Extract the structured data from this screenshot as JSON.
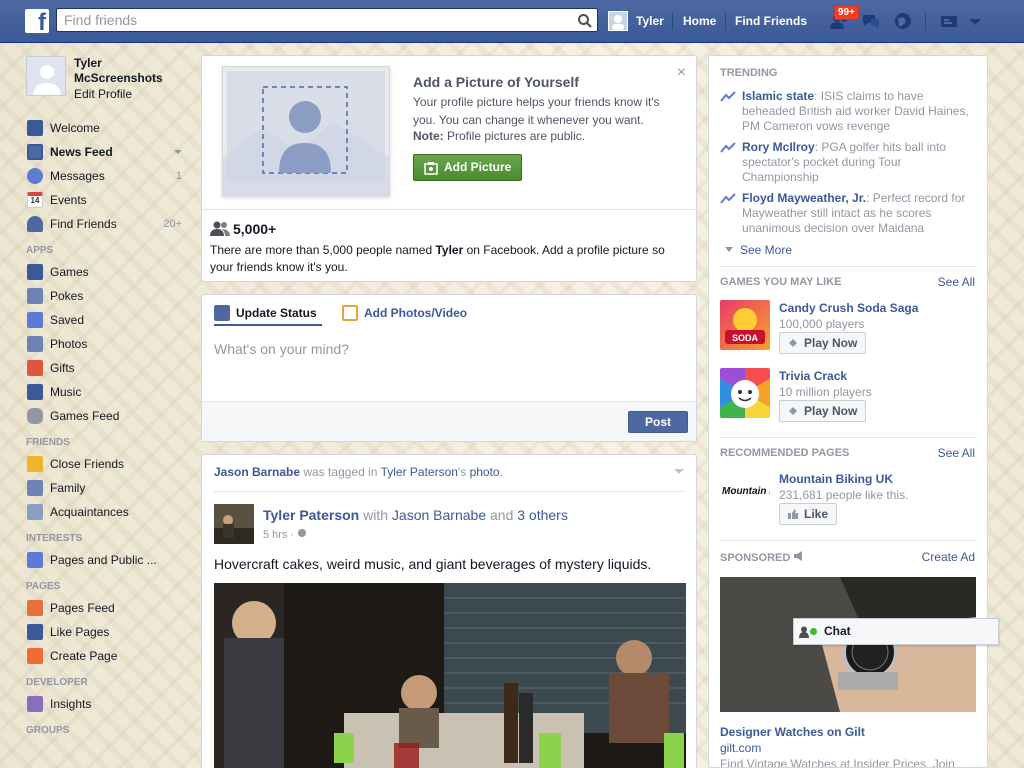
{
  "topbar": {
    "logo": "f",
    "search_placeholder": "Find friends",
    "user_name": "Tyler",
    "home": "Home",
    "find_friends": "Find Friends",
    "friend_requests_badge": "99+"
  },
  "profile": {
    "name": "Tyler McScreenshots",
    "edit": "Edit Profile"
  },
  "nav": {
    "main": [
      {
        "label": "Welcome"
      },
      {
        "label": "News Feed"
      },
      {
        "label": "Messages",
        "count": "1"
      },
      {
        "label": "Events",
        "icon_text": "14"
      },
      {
        "label": "Find Friends",
        "count": "20+"
      }
    ],
    "apps_heading": "APPS",
    "apps": [
      {
        "label": "Games"
      },
      {
        "label": "Pokes"
      },
      {
        "label": "Saved"
      },
      {
        "label": "Photos"
      },
      {
        "label": "Gifts"
      },
      {
        "label": "Music"
      },
      {
        "label": "Games Feed"
      }
    ],
    "friends_heading": "FRIENDS",
    "friends": [
      {
        "label": "Close Friends"
      },
      {
        "label": "Family"
      },
      {
        "label": "Acquaintances"
      }
    ],
    "interests_heading": "INTERESTS",
    "interests": [
      {
        "label": "Pages and Public ..."
      }
    ],
    "pages_heading": "PAGES",
    "pages": [
      {
        "label": "Pages Feed"
      },
      {
        "label": "Like Pages"
      },
      {
        "label": "Create Page"
      }
    ],
    "developer_heading": "DEVELOPER",
    "developer": [
      {
        "label": "Insights"
      }
    ],
    "groups_heading": "GROUPS"
  },
  "add_picture": {
    "title": "Add a Picture of Yourself",
    "text": "Your profile picture helps your friends know it's you. You can change it whenever you want.",
    "note_label": "Note:",
    "note_text": " Profile pictures are public.",
    "button": "Add Picture",
    "close": "×",
    "count": "5,000+",
    "desc_prefix": "There are more than 5,000 people named ",
    "desc_name": "Tyler",
    "desc_suffix": " on Facebook. Add a profile picture so your friends know it's you."
  },
  "composer": {
    "tab_status": "Update Status",
    "tab_photos": "Add Photos/Video",
    "placeholder": "What's on your mind?",
    "post_button": "Post"
  },
  "story": {
    "header_actor": "Jason Barnabe",
    "header_mid": " was tagged in ",
    "header_owner": "Tyler Paterson",
    "header_poss": "'s ",
    "header_obj": "photo",
    "header_end": ".",
    "author": "Tyler Paterson",
    "with": " with ",
    "with_name": "Jason Barnabe",
    "and": " and ",
    "others": "3 others",
    "time": "5 hrs · ",
    "text": "Hovercraft cakes, weird music, and giant beverages of mystery liquids."
  },
  "trending": {
    "heading": "TRENDING",
    "items": [
      {
        "topic": "Islamic state",
        "desc": ": ISIS claims to have beheaded British aid worker David Haines, PM Cameron vows revenge"
      },
      {
        "topic": "Rory McIlroy",
        "desc": ": PGA golfer hits ball into spectator's pocket during Tour Championship"
      },
      {
        "topic": "Floyd Mayweather, Jr.",
        "desc": ": Perfect record for Mayweather still intact as he scores unanimous decision over Maidana"
      }
    ],
    "see_more": "See More"
  },
  "games": {
    "heading": "GAMES YOU MAY LIKE",
    "see_all": "See All",
    "items": [
      {
        "name": "Candy Crush Soda Saga",
        "players": "100,000 players",
        "button": "Play Now",
        "icon_text": "SODA"
      },
      {
        "name": "Trivia Crack",
        "players": "10 million players",
        "button": "Play Now"
      }
    ]
  },
  "recommended": {
    "heading": "RECOMMENDED PAGES",
    "see_all": "See All",
    "name": "Mountain Biking UK",
    "likes": "231,681 people like this.",
    "button": "Like",
    "logo_text": "Mountain Biking"
  },
  "sponsored": {
    "heading": "SPONSORED",
    "create_ad": "Create Ad",
    "title": "Designer Watches on Gilt",
    "url": "gilt.com",
    "desc": "Find Vintage Watches at Insider Prices. Join"
  },
  "chat": {
    "label": "Chat"
  }
}
